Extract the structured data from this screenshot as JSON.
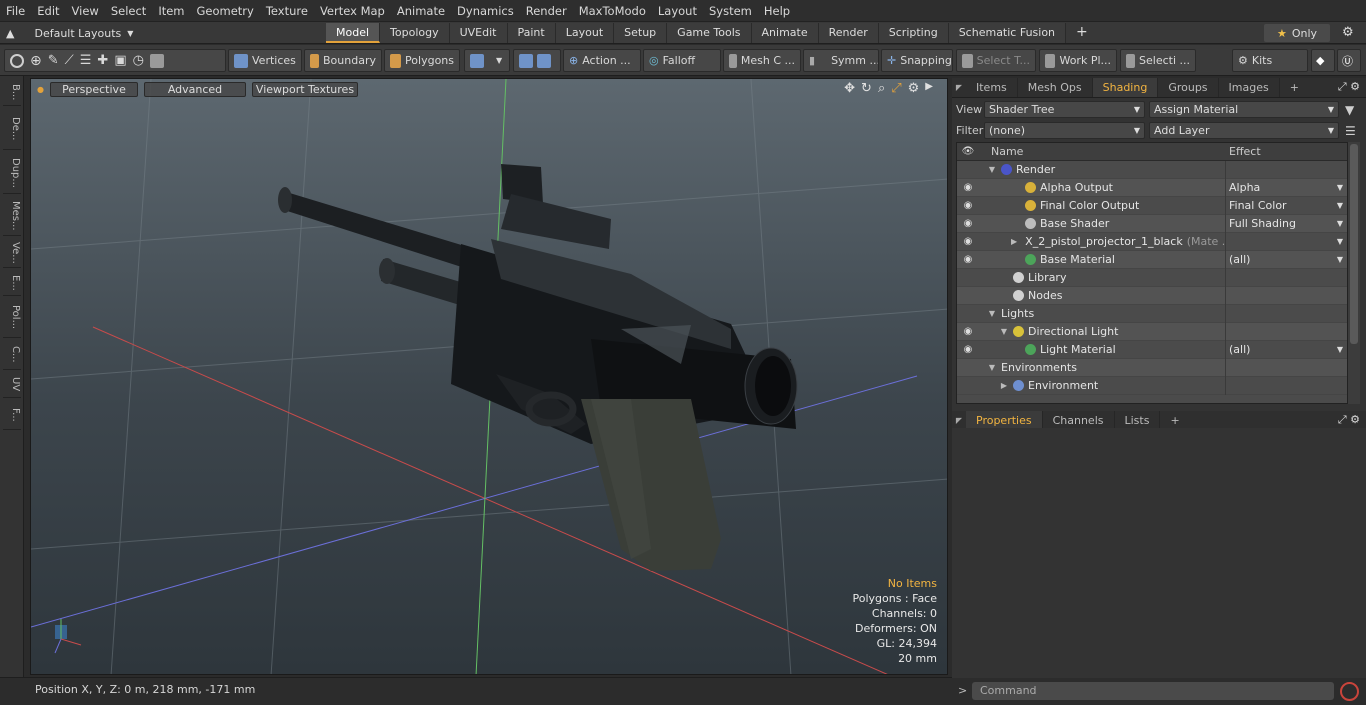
{
  "menu": [
    "File",
    "Edit",
    "View",
    "Select",
    "Item",
    "Geometry",
    "Texture",
    "Vertex Map",
    "Animate",
    "Dynamics",
    "Render",
    "MaxToModo",
    "Layout",
    "System",
    "Help"
  ],
  "layout": {
    "selector": "Default Layouts",
    "only_label": "Only"
  },
  "tabs": [
    {
      "label": "Model",
      "active": true
    },
    {
      "label": "Topology"
    },
    {
      "label": "UVEdit"
    },
    {
      "label": "Paint"
    },
    {
      "label": "Layout"
    },
    {
      "label": "Setup"
    },
    {
      "label": "Game Tools"
    },
    {
      "label": "Animate"
    },
    {
      "label": "Render"
    },
    {
      "label": "Scripting"
    },
    {
      "label": "Schematic Fusion"
    },
    {
      "label": "+"
    }
  ],
  "toolbar": {
    "vertices": "Vertices",
    "boundary": "Boundary",
    "polygons": "Polygons",
    "action": "Action ...",
    "falloff": "Falloff",
    "mesh": "Mesh C ...",
    "symm": "Symm ...",
    "snapping": "Snapping",
    "select_t": "Select T...",
    "work_pl": "Work Pl...",
    "selecti": "Selecti ...",
    "kits": "Kits"
  },
  "left_tabs": [
    "B...",
    "De...",
    "Dup...",
    "Mes...",
    "Ve...",
    "E...",
    "Pol...",
    "C...",
    "UV",
    "F..."
  ],
  "viewport": {
    "buttons": [
      "Perspective",
      "Advanced",
      "Viewport Textures"
    ],
    "stats": {
      "no_items": "No Items",
      "polygons": "Polygons : Face",
      "channels": "Channels: 0",
      "deformers": "Deformers: ON",
      "gl": "GL: 24,394",
      "scale": "20 mm"
    }
  },
  "status": {
    "position": "Position X, Y, Z:   0 m, 218 mm, -171 mm"
  },
  "shading_tabs": [
    {
      "label": "Items"
    },
    {
      "label": "Mesh Ops"
    },
    {
      "label": "Shading",
      "active": true
    },
    {
      "label": "Groups"
    },
    {
      "label": "Images"
    },
    {
      "label": "+"
    }
  ],
  "shading": {
    "view_label": "View",
    "view_value": "Shader Tree",
    "assign": "Assign Material",
    "filter_label": "Filter",
    "filter_value": "(none)",
    "add_layer": "Add Layer",
    "col_name": "Name",
    "col_effect": "Effect",
    "rows": [
      {
        "name": "Render",
        "effect": "",
        "indent": 0,
        "eye": false,
        "expand": "▼",
        "color": "#4a55c9"
      },
      {
        "name": "Alpha Output",
        "effect": "Alpha",
        "indent": 2,
        "eye": true,
        "color": "#d8b13a",
        "dd": true
      },
      {
        "name": "Final Color Output",
        "effect": "Final Color",
        "indent": 2,
        "eye": true,
        "color": "#d8b13a",
        "dd": true
      },
      {
        "name": "Base Shader",
        "effect": "Full Shading",
        "indent": 2,
        "eye": true,
        "color": "#bdbdbd",
        "dd": true
      },
      {
        "name": "X_2_pistol_projector_1_black",
        "suffix": "(Mate ...",
        "effect": "",
        "indent": 2,
        "eye": true,
        "expand": "▶",
        "color": "#c84a4a",
        "dd": true
      },
      {
        "name": "Base Material",
        "effect": "(all)",
        "indent": 2,
        "eye": true,
        "color": "#4ca45a",
        "dd": true
      },
      {
        "name": "Library",
        "effect": "",
        "indent": 1,
        "eye": false,
        "color": "#d0d0d0"
      },
      {
        "name": "Nodes",
        "effect": "",
        "indent": 1,
        "eye": false,
        "color": "#d0d0d0"
      },
      {
        "name": "Lights",
        "effect": "",
        "indent": 0,
        "eye": false,
        "expand": "▼"
      },
      {
        "name": "Directional Light",
        "effect": "",
        "indent": 1,
        "eye": true,
        "expand": "▼",
        "color": "#d8c23a"
      },
      {
        "name": "Light Material",
        "effect": "(all)",
        "indent": 2,
        "eye": true,
        "color": "#4ca45a",
        "dd": true
      },
      {
        "name": "Environments",
        "effect": "",
        "indent": 0,
        "eye": false,
        "expand": "▼"
      },
      {
        "name": "Environment",
        "effect": "",
        "indent": 1,
        "eye": false,
        "expand": "▶",
        "color": "#6e8fd0"
      }
    ]
  },
  "props_tabs": [
    {
      "label": "Properties",
      "active": true
    },
    {
      "label": "Channels"
    },
    {
      "label": "Lists"
    },
    {
      "label": "+"
    }
  ],
  "command": {
    "placeholder": "Command"
  }
}
